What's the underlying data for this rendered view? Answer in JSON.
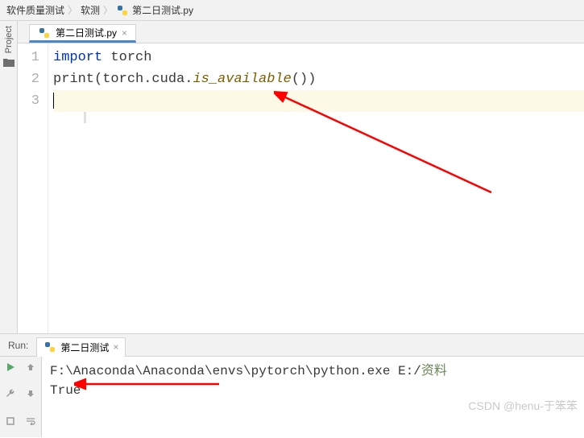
{
  "breadcrumb": {
    "root": "软件质量测试",
    "mid": "软测",
    "file": "第二日测试.py"
  },
  "sidebar": {
    "label": "Project"
  },
  "tab": {
    "label": "第二日测试.py"
  },
  "code": {
    "lines": [
      "1",
      "2",
      "3"
    ],
    "l1_kw": "import",
    "l1_rest": " torch",
    "l2_print": "print",
    "l2_open": "(torch.cuda.",
    "l2_fn": "is_available",
    "l2_close": "())"
  },
  "run": {
    "title": "Run:",
    "tab_label": "第二日测试",
    "path_prefix": "F:\\Anaconda\\Anaconda\\envs\\pytorch\\python.exe E:/",
    "path_cn": "资料",
    "output": "True"
  },
  "watermark": "CSDN @henu-于笨笨"
}
